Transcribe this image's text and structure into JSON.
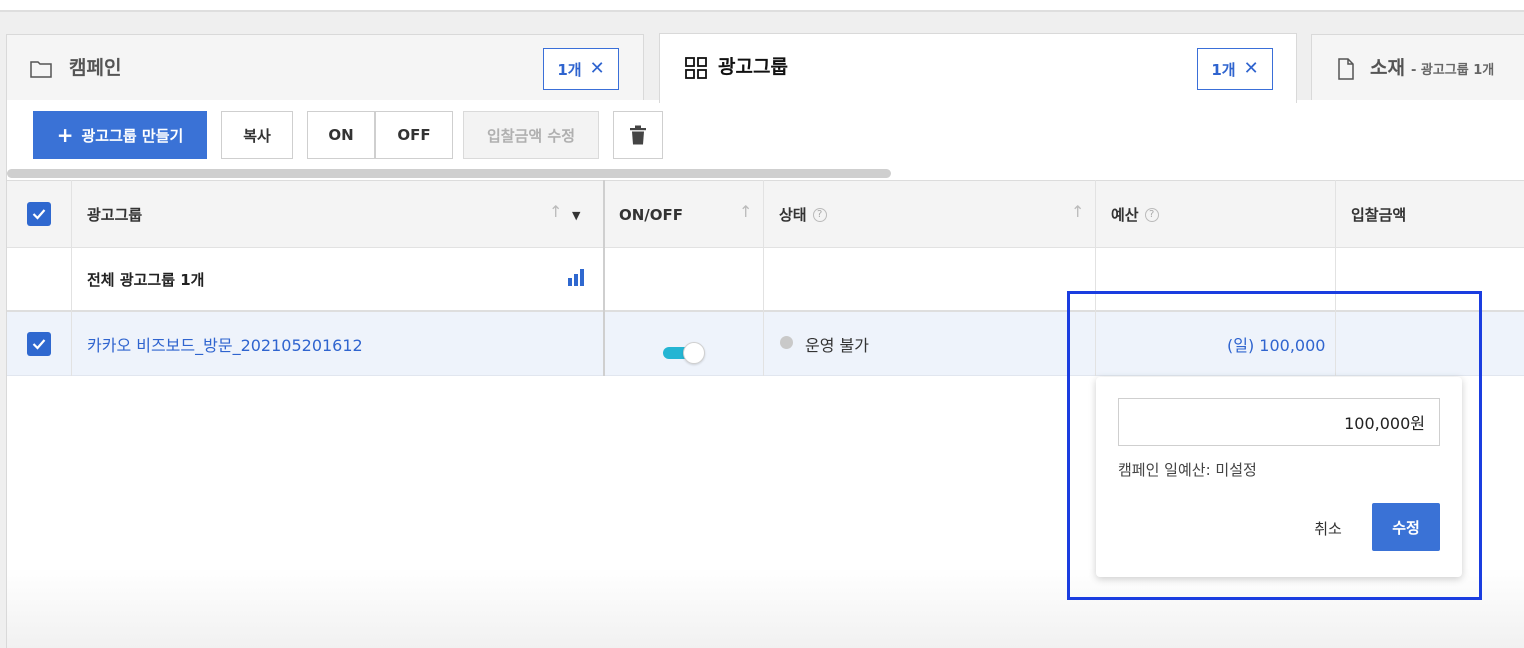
{
  "tabs": {
    "campaign": {
      "label": "캠페인",
      "count": "1개",
      "icon": "folder-icon"
    },
    "adgroup": {
      "label": "광고그룹",
      "count": "1개",
      "icon": "grid-icon"
    },
    "creative": {
      "label": "소재",
      "sub": "- 광고그룹 1개",
      "icon": "document-icon"
    }
  },
  "toolbar": {
    "create_label": "광고그룹 만들기",
    "copy_label": "복사",
    "on_label": "ON",
    "off_label": "OFF",
    "bid_label": "입찰금액 수정",
    "trash_icon": "trash-icon"
  },
  "table": {
    "headers": {
      "adgroup": "광고그룹",
      "onoff": "ON/OFF",
      "status": "상태",
      "budget": "예산",
      "bid": "입찰금액"
    },
    "total_row": {
      "label": "전체 광고그룹 1개"
    },
    "rows": [
      {
        "name": "카카오 비즈보드_방문_202105201612",
        "on": true,
        "status": "운영 불가",
        "budget": "(일) 100,000"
      }
    ]
  },
  "budget_popup": {
    "value": "100,000원",
    "note": "캠페인 일예산: 미설정",
    "cancel_label": "취소",
    "submit_label": "수정"
  },
  "colors": {
    "primary": "#3a72d6",
    "link": "#2f64cf",
    "toggle_on": "#24b5d3",
    "highlight": "#1a3de0"
  }
}
